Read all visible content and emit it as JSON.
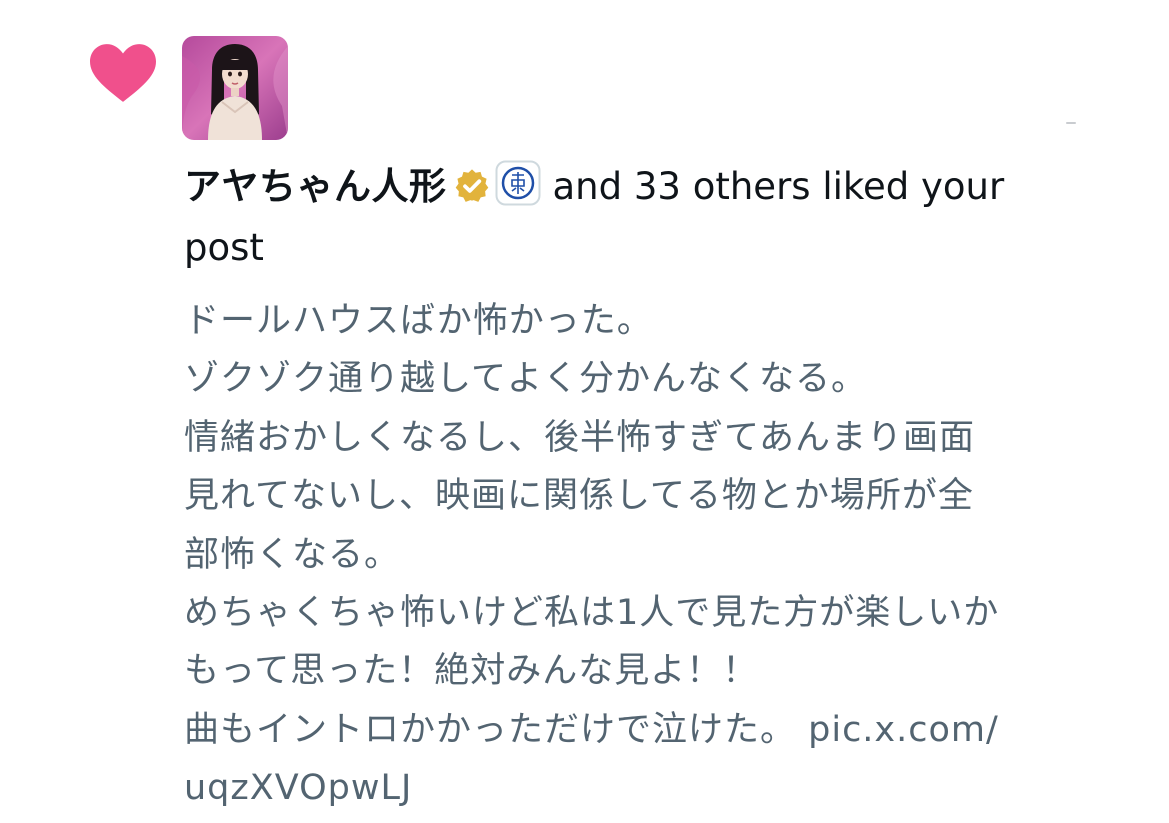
{
  "notification": {
    "type_icon": "heart-icon",
    "accent_color": "#f91880",
    "avatar": "doll-avatar",
    "user_name": "アヤちゃん人形",
    "verified_badge": "verified-gold-badge-icon",
    "affiliate_badge": "toho-affiliate-icon",
    "action_text_line1": "and 33 others liked your",
    "action_text_line2": "post"
  },
  "post": {
    "lines": [
      "ドールハウスばか怖かった。",
      "ゾクゾク通り越してよく分かんなくなる。",
      "情緒おかしくなるし、後半怖すぎてあんまり画面",
      "見れてないし、映画に関係してる物とか場所が全",
      "部怖くなる。",
      "めちゃくちゃ怖いけど私は1人で見た方が楽しいか",
      "もって思った！絶対みんな見よ！！",
      "曲もイントロかかっただけで泣けた。 pic.x.com/",
      "uqzXVOpwLJ"
    ],
    "text_color": "#536471"
  }
}
